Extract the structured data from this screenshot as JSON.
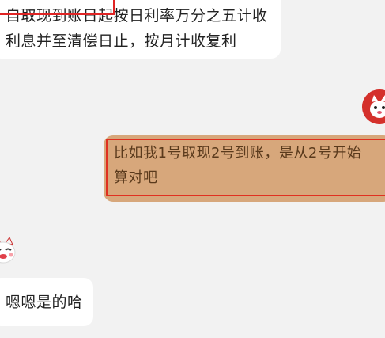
{
  "messages": {
    "m1": {
      "line1": "自取现到账日起按日利率万分之五计收",
      "line2": "利息并至清偿日止，按月计收复利"
    },
    "m2": {
      "line1": "比如我1号取现2号到账，是从2号开始",
      "line2": "算对吧"
    },
    "m3": {
      "line1": "嗯嗯是的哈"
    }
  },
  "colors": {
    "background": "#f2f2f2",
    "received_bubble": "#ffffff",
    "sent_bubble": "#d7a77b",
    "annotation_red": "#e02424"
  },
  "icons": {
    "avatar_right": "cat-face-avatar-icon",
    "avatar_left": "cat-face-avatar-icon"
  }
}
